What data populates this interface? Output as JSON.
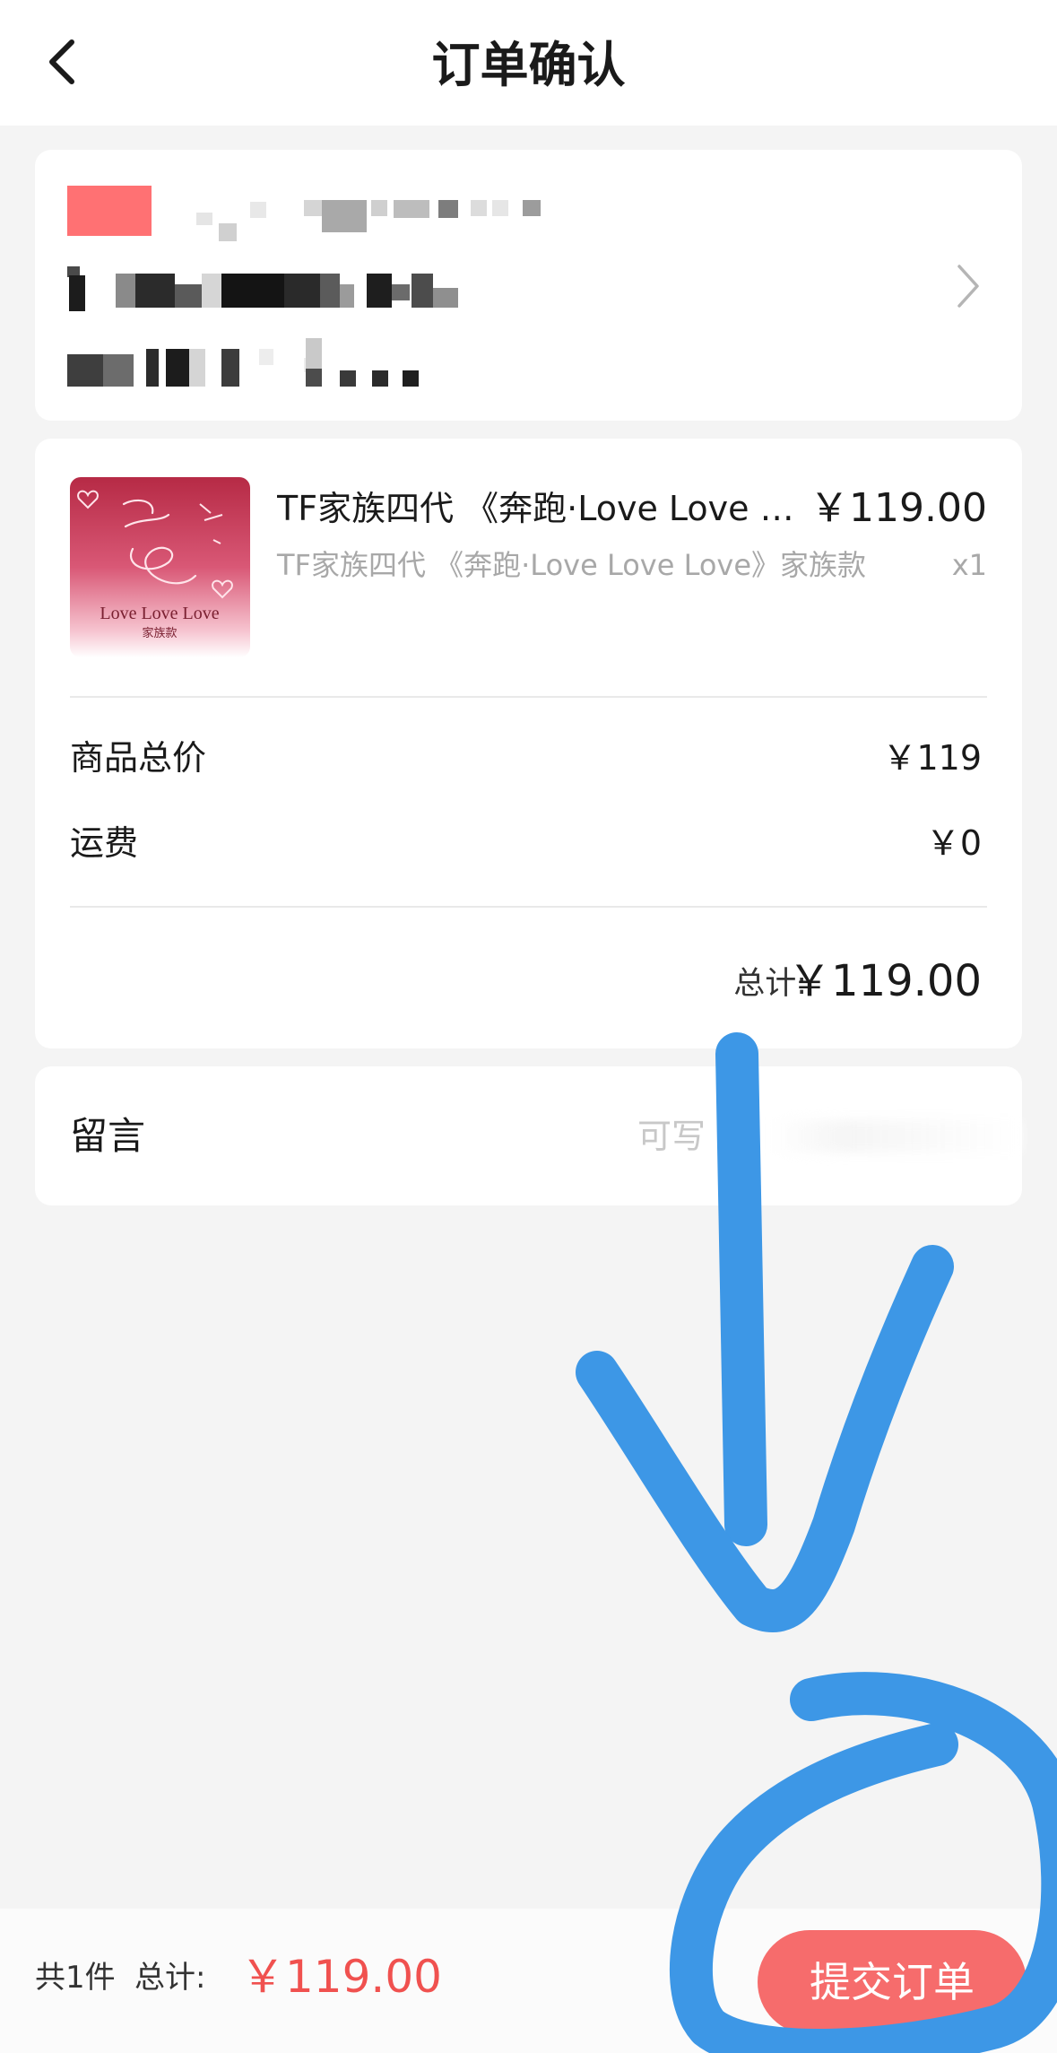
{
  "header": {
    "title": "订单确认",
    "back_icon": "chevron-left-icon"
  },
  "address": {
    "chevron_icon": "chevron-right-icon",
    "note": "pixelated / redacted recipient info"
  },
  "product": {
    "title": "TF家族四代 《奔跑·Love Love Love》家族款",
    "price": "￥119.00",
    "variant": "TF家族四代 《奔跑·Love Love Love》家族款",
    "quantity": "x1",
    "thumb_text_1": "Love Love Love",
    "thumb_text_2": "家族款"
  },
  "summary": {
    "goods_label": "商品总价",
    "goods_value": "￥119",
    "shipping_label": "运费",
    "shipping_value": "￥0",
    "total_label": "总计:",
    "total_value": "￥119.00"
  },
  "message": {
    "label": "留言",
    "placeholder": "可写"
  },
  "bottom_bar": {
    "count": "共1件",
    "total_label": "总计:",
    "total_value": "￥119.00",
    "submit_label": "提交订单"
  },
  "colors": {
    "accent": "#f66c6c",
    "price_red": "#f0514f",
    "annotation_blue": "#3d97e6",
    "background": "#f4f4f4"
  }
}
